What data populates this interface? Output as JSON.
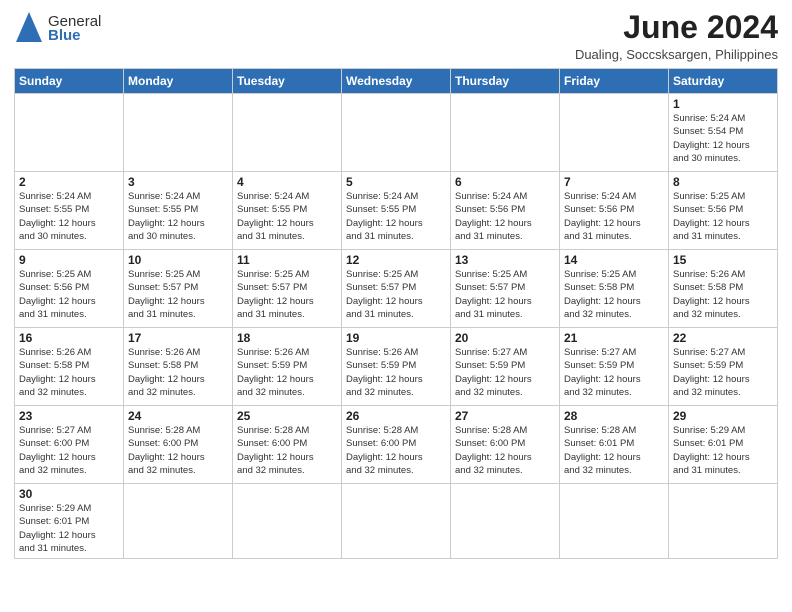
{
  "logo": {
    "text_general": "General",
    "text_blue": "Blue"
  },
  "title": "June 2024",
  "location": "Dualing, Soccsksargen, Philippines",
  "weekdays": [
    "Sunday",
    "Monday",
    "Tuesday",
    "Wednesday",
    "Thursday",
    "Friday",
    "Saturday"
  ],
  "days": {
    "1": {
      "sunrise": "5:24 AM",
      "sunset": "5:54 PM",
      "daylight": "12 hours and 30 minutes."
    },
    "2": {
      "sunrise": "5:24 AM",
      "sunset": "5:55 PM",
      "daylight": "12 hours and 30 minutes."
    },
    "3": {
      "sunrise": "5:24 AM",
      "sunset": "5:55 PM",
      "daylight": "12 hours and 30 minutes."
    },
    "4": {
      "sunrise": "5:24 AM",
      "sunset": "5:55 PM",
      "daylight": "12 hours and 31 minutes."
    },
    "5": {
      "sunrise": "5:24 AM",
      "sunset": "5:55 PM",
      "daylight": "12 hours and 31 minutes."
    },
    "6": {
      "sunrise": "5:24 AM",
      "sunset": "5:56 PM",
      "daylight": "12 hours and 31 minutes."
    },
    "7": {
      "sunrise": "5:24 AM",
      "sunset": "5:56 PM",
      "daylight": "12 hours and 31 minutes."
    },
    "8": {
      "sunrise": "5:25 AM",
      "sunset": "5:56 PM",
      "daylight": "12 hours and 31 minutes."
    },
    "9": {
      "sunrise": "5:25 AM",
      "sunset": "5:56 PM",
      "daylight": "12 hours and 31 minutes."
    },
    "10": {
      "sunrise": "5:25 AM",
      "sunset": "5:57 PM",
      "daylight": "12 hours and 31 minutes."
    },
    "11": {
      "sunrise": "5:25 AM",
      "sunset": "5:57 PM",
      "daylight": "12 hours and 31 minutes."
    },
    "12": {
      "sunrise": "5:25 AM",
      "sunset": "5:57 PM",
      "daylight": "12 hours and 31 minutes."
    },
    "13": {
      "sunrise": "5:25 AM",
      "sunset": "5:57 PM",
      "daylight": "12 hours and 31 minutes."
    },
    "14": {
      "sunrise": "5:25 AM",
      "sunset": "5:58 PM",
      "daylight": "12 hours and 32 minutes."
    },
    "15": {
      "sunrise": "5:26 AM",
      "sunset": "5:58 PM",
      "daylight": "12 hours and 32 minutes."
    },
    "16": {
      "sunrise": "5:26 AM",
      "sunset": "5:58 PM",
      "daylight": "12 hours and 32 minutes."
    },
    "17": {
      "sunrise": "5:26 AM",
      "sunset": "5:58 PM",
      "daylight": "12 hours and 32 minutes."
    },
    "18": {
      "sunrise": "5:26 AM",
      "sunset": "5:59 PM",
      "daylight": "12 hours and 32 minutes."
    },
    "19": {
      "sunrise": "5:26 AM",
      "sunset": "5:59 PM",
      "daylight": "12 hours and 32 minutes."
    },
    "20": {
      "sunrise": "5:27 AM",
      "sunset": "5:59 PM",
      "daylight": "12 hours and 32 minutes."
    },
    "21": {
      "sunrise": "5:27 AM",
      "sunset": "5:59 PM",
      "daylight": "12 hours and 32 minutes."
    },
    "22": {
      "sunrise": "5:27 AM",
      "sunset": "5:59 PM",
      "daylight": "12 hours and 32 minutes."
    },
    "23": {
      "sunrise": "5:27 AM",
      "sunset": "6:00 PM",
      "daylight": "12 hours and 32 minutes."
    },
    "24": {
      "sunrise": "5:28 AM",
      "sunset": "6:00 PM",
      "daylight": "12 hours and 32 minutes."
    },
    "25": {
      "sunrise": "5:28 AM",
      "sunset": "6:00 PM",
      "daylight": "12 hours and 32 minutes."
    },
    "26": {
      "sunrise": "5:28 AM",
      "sunset": "6:00 PM",
      "daylight": "12 hours and 32 minutes."
    },
    "27": {
      "sunrise": "5:28 AM",
      "sunset": "6:00 PM",
      "daylight": "12 hours and 32 minutes."
    },
    "28": {
      "sunrise": "5:28 AM",
      "sunset": "6:01 PM",
      "daylight": "12 hours and 32 minutes."
    },
    "29": {
      "sunrise": "5:29 AM",
      "sunset": "6:01 PM",
      "daylight": "12 hours and 31 minutes."
    },
    "30": {
      "sunrise": "5:29 AM",
      "sunset": "6:01 PM",
      "daylight": "12 hours and 31 minutes."
    }
  },
  "labels": {
    "sunrise": "Sunrise:",
    "sunset": "Sunset:",
    "daylight": "Daylight:"
  }
}
